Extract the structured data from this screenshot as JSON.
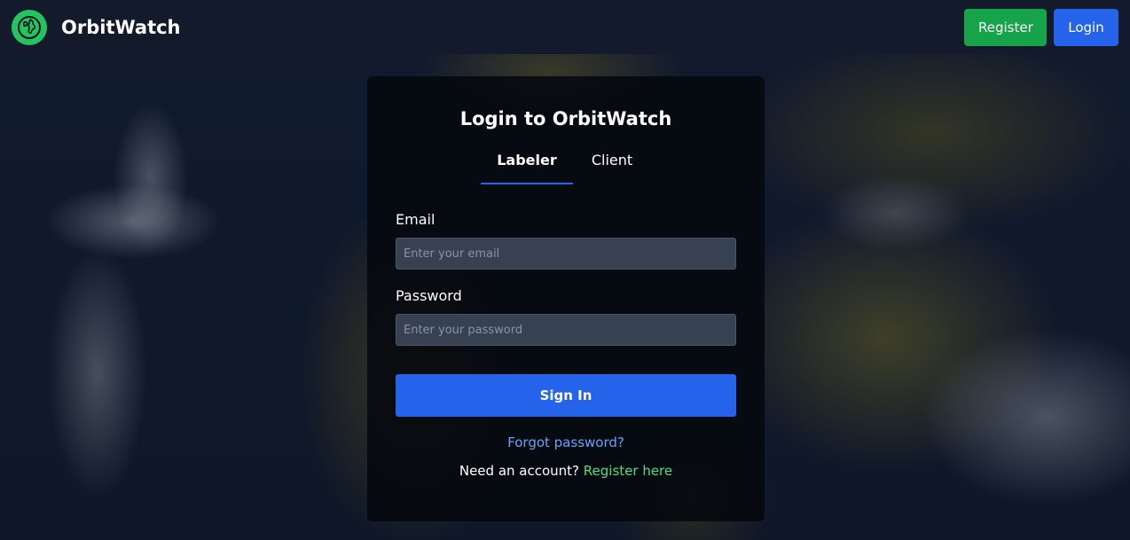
{
  "brand": {
    "name": "OrbitWatch",
    "logo_icon": "globe-icon"
  },
  "nav": {
    "register_label": "Register",
    "login_label": "Login"
  },
  "login": {
    "title": "Login to OrbitWatch",
    "tabs": [
      {
        "label": "Labeler",
        "active": true
      },
      {
        "label": "Client",
        "active": false
      }
    ],
    "email_label": "Email",
    "email_placeholder": "Enter your email",
    "password_label": "Password",
    "password_placeholder": "Enter your password",
    "signin_label": "Sign In",
    "forgot_label": "Forgot password?",
    "need_account_text": "Need an account?",
    "register_link_label": "Register here"
  },
  "colors": {
    "primary": "#2563eb",
    "success": "#16a34a",
    "link": "#60a5fa",
    "register_link": "#4ade80"
  }
}
